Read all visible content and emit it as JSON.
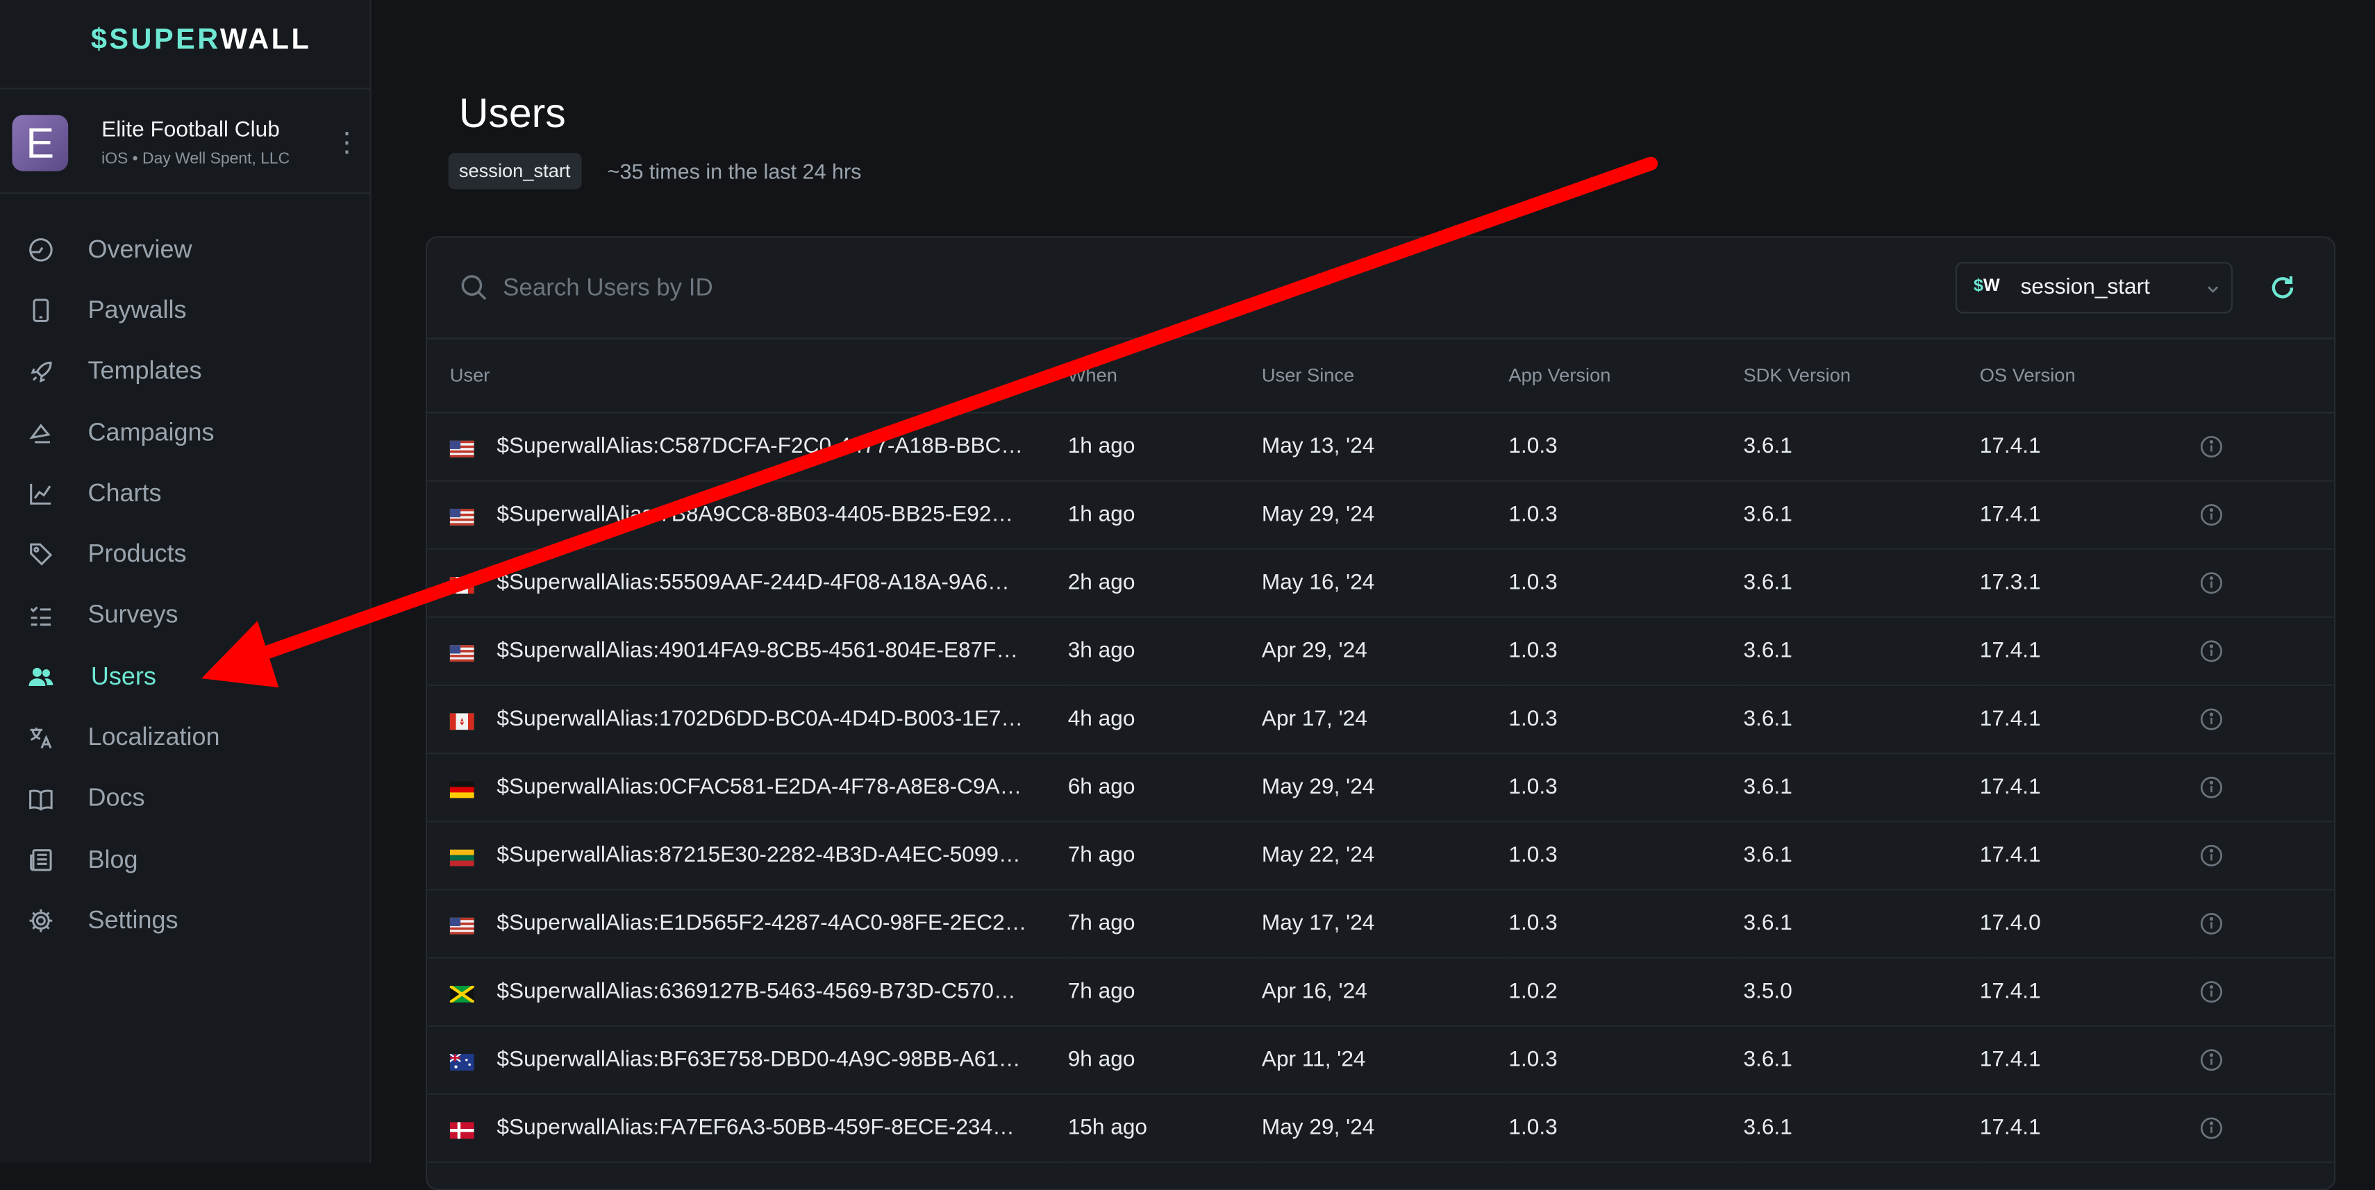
{
  "brand": {
    "logo_prefix": "$",
    "logo_accent": "SUPER",
    "logo_rest": "WALL",
    "accent_color": "#6ee7d3"
  },
  "app": {
    "name": "Elite Football Club",
    "subtitle": "iOS • Day Well Spent, LLC",
    "avatar_letter": "E",
    "menu_icon": "more-vertical-icon"
  },
  "sidebar": {
    "items": [
      {
        "label": "Overview",
        "icon": "gauge-icon",
        "active": false
      },
      {
        "label": "Paywalls",
        "icon": "phone-icon",
        "active": false
      },
      {
        "label": "Templates",
        "icon": "rocket-icon",
        "active": false
      },
      {
        "label": "Campaigns",
        "icon": "megaphone-icon",
        "active": false
      },
      {
        "label": "Charts",
        "icon": "line-chart-icon",
        "active": false
      },
      {
        "label": "Products",
        "icon": "tag-icon",
        "active": false
      },
      {
        "label": "Surveys",
        "icon": "checklist-icon",
        "active": false
      },
      {
        "label": "Users",
        "icon": "users-icon",
        "active": true
      },
      {
        "label": "Localization",
        "icon": "translate-icon",
        "active": false
      },
      {
        "label": "Docs",
        "icon": "book-icon",
        "active": false
      },
      {
        "label": "Blog",
        "icon": "newspaper-icon",
        "active": false
      },
      {
        "label": "Settings",
        "icon": "gear-icon",
        "active": false
      }
    ]
  },
  "page": {
    "title": "Users",
    "event_chip": "session_start",
    "event_summary": "~35 times in the last 24 hrs"
  },
  "toolbar": {
    "search_placeholder": "Search Users by ID",
    "event_select_prefix": "$W",
    "event_select_value": "session_start",
    "refresh_icon": "refresh-icon"
  },
  "table": {
    "headers": [
      "User",
      "When",
      "User Since",
      "App Version",
      "SDK Version",
      "OS Version"
    ],
    "rows": [
      {
        "flag": "us",
        "user": "$SuperwallAlias:C587DCFA-F2C0-4477-A18B-BBC…",
        "when": "1h ago",
        "since": "May 13, '24",
        "app": "1.0.3",
        "sdk": "3.6.1",
        "os": "17.4.1"
      },
      {
        "flag": "us",
        "user": "$SuperwallAlias:7B8A9CC8-8B03-4405-BB25-E92…",
        "when": "1h ago",
        "since": "May 29, '24",
        "app": "1.0.3",
        "sdk": "3.6.1",
        "os": "17.4.1"
      },
      {
        "flag": "ca",
        "user": "$SuperwallAlias:55509AAF-244D-4F08-A18A-9A6…",
        "when": "2h ago",
        "since": "May 16, '24",
        "app": "1.0.3",
        "sdk": "3.6.1",
        "os": "17.3.1"
      },
      {
        "flag": "us",
        "user": "$SuperwallAlias:49014FA9-8CB5-4561-804E-E87F…",
        "when": "3h ago",
        "since": "Apr 29, '24",
        "app": "1.0.3",
        "sdk": "3.6.1",
        "os": "17.4.1"
      },
      {
        "flag": "ca",
        "user": "$SuperwallAlias:1702D6DD-BC0A-4D4D-B003-1E7…",
        "when": "4h ago",
        "since": "Apr 17, '24",
        "app": "1.0.3",
        "sdk": "3.6.1",
        "os": "17.4.1"
      },
      {
        "flag": "de",
        "user": "$SuperwallAlias:0CFAC581-E2DA-4F78-A8E8-C9A…",
        "when": "6h ago",
        "since": "May 29, '24",
        "app": "1.0.3",
        "sdk": "3.6.1",
        "os": "17.4.1"
      },
      {
        "flag": "lt",
        "user": "$SuperwallAlias:87215E30-2282-4B3D-A4EC-5099…",
        "when": "7h ago",
        "since": "May 22, '24",
        "app": "1.0.3",
        "sdk": "3.6.1",
        "os": "17.4.1"
      },
      {
        "flag": "us",
        "user": "$SuperwallAlias:E1D565F2-4287-4AC0-98FE-2EC2…",
        "when": "7h ago",
        "since": "May 17, '24",
        "app": "1.0.3",
        "sdk": "3.6.1",
        "os": "17.4.0"
      },
      {
        "flag": "jm",
        "user": "$SuperwallAlias:6369127B-5463-4569-B73D-C570…",
        "when": "7h ago",
        "since": "Apr 16, '24",
        "app": "1.0.2",
        "sdk": "3.5.0",
        "os": "17.4.1"
      },
      {
        "flag": "au",
        "user": "$SuperwallAlias:BF63E758-DBD0-4A9C-98BB-A61…",
        "when": "9h ago",
        "since": "Apr 11, '24",
        "app": "1.0.3",
        "sdk": "3.6.1",
        "os": "17.4.1"
      },
      {
        "flag": "dk",
        "user": "$SuperwallAlias:FA7EF6A3-50BB-459F-8ECE-234…",
        "when": "15h ago",
        "since": "May 29, '24",
        "app": "1.0.3",
        "sdk": "3.6.1",
        "os": "17.4.1"
      }
    ],
    "row_info_icon": "info-icon"
  },
  "annotation": {
    "type": "arrow",
    "color": "#ff0000",
    "points_to": "Users"
  }
}
